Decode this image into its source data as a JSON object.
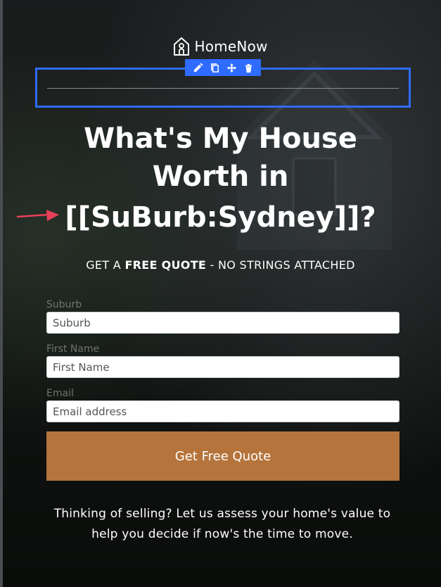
{
  "brand": {
    "name": "HomeNow",
    "icon": "house-icon"
  },
  "editor_toolbar": {
    "tools": [
      {
        "name": "edit-pencil-icon"
      },
      {
        "name": "duplicate-icon"
      },
      {
        "name": "move-icon"
      },
      {
        "name": "delete-icon"
      }
    ],
    "selection_color": "#2f6bff"
  },
  "headline": {
    "line1": "What's My House",
    "line2": "Worth in",
    "line3": "[[SuBurb:Sydney]]?"
  },
  "subtitle": {
    "prefix": "GET A ",
    "emphasis": "FREE QUOTE",
    "suffix": " - NO STRINGS ATTACHED"
  },
  "form": {
    "suburb": {
      "label": "Suburb",
      "placeholder": "Suburb"
    },
    "first_name": {
      "label": "First Name",
      "placeholder": "First Name"
    },
    "email": {
      "label": "Email",
      "placeholder": "Email address"
    },
    "submit_label": "Get Free Quote",
    "submit_color": "#b5743b"
  },
  "blurb": {
    "line1": "Thinking of selling? Let us assess your home's value to",
    "line2": "help you decide if now's the time to move."
  },
  "annotation": {
    "arrow_color": "#e8405a"
  }
}
